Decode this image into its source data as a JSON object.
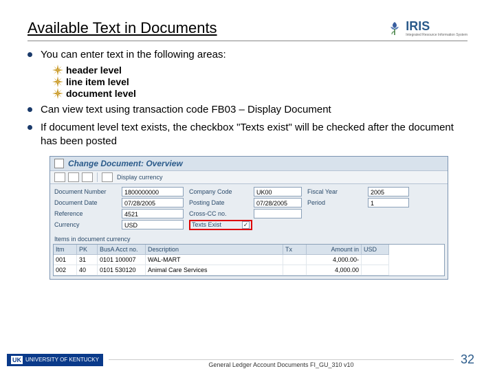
{
  "header": {
    "title": "Available Text in Documents",
    "logo": {
      "text": "IRIS",
      "sub": "Integrated Resource\nInformation System"
    }
  },
  "bullets": [
    {
      "text": "You can enter text in the following areas:",
      "subs": [
        "header level",
        "line item level",
        "document level"
      ]
    },
    {
      "text": "Can view text using transaction code FB03 – Display Document"
    },
    {
      "text": "If document level text exists, the checkbox \"Texts exist\" will be checked after the document has been posted"
    }
  ],
  "screenshot": {
    "title": "Change Document: Overview",
    "toolbar_label": "Display currency",
    "form": {
      "doc_num_label": "Document Number",
      "doc_num": "1800000000",
      "company_label": "Company Code",
      "company": "UK00",
      "fy_label": "Fiscal Year",
      "fy": "2005",
      "docdate_label": "Document Date",
      "docdate": "07/28/2005",
      "postdate_label": "Posting Date",
      "postdate": "07/28/2005",
      "period_label": "Period",
      "period": "1",
      "ref_label": "Reference",
      "ref": "4521",
      "cross_label": "Cross-CC no.",
      "curr_label": "Currency",
      "curr": "USD",
      "texts_label": "Texts Exist",
      "texts_checked": "✓"
    },
    "items_label": "Items in document currency",
    "table": {
      "headers": [
        "Itm",
        "PK",
        "BusA Acct no.",
        "Description",
        "Tx",
        "Amount in",
        "USD"
      ],
      "rows": [
        [
          "001",
          "31",
          "0101 100007",
          "WAL-MART",
          "",
          "4,000.00-",
          ""
        ],
        [
          "002",
          "40",
          "0101 530120",
          "Animal Care Services",
          "",
          "4,000.00",
          ""
        ]
      ]
    }
  },
  "footer": {
    "uk": "UNIVERSITY OF KENTUCKY",
    "text": "General Ledger Account Documents FI_GU_310 v10",
    "page": "32"
  }
}
